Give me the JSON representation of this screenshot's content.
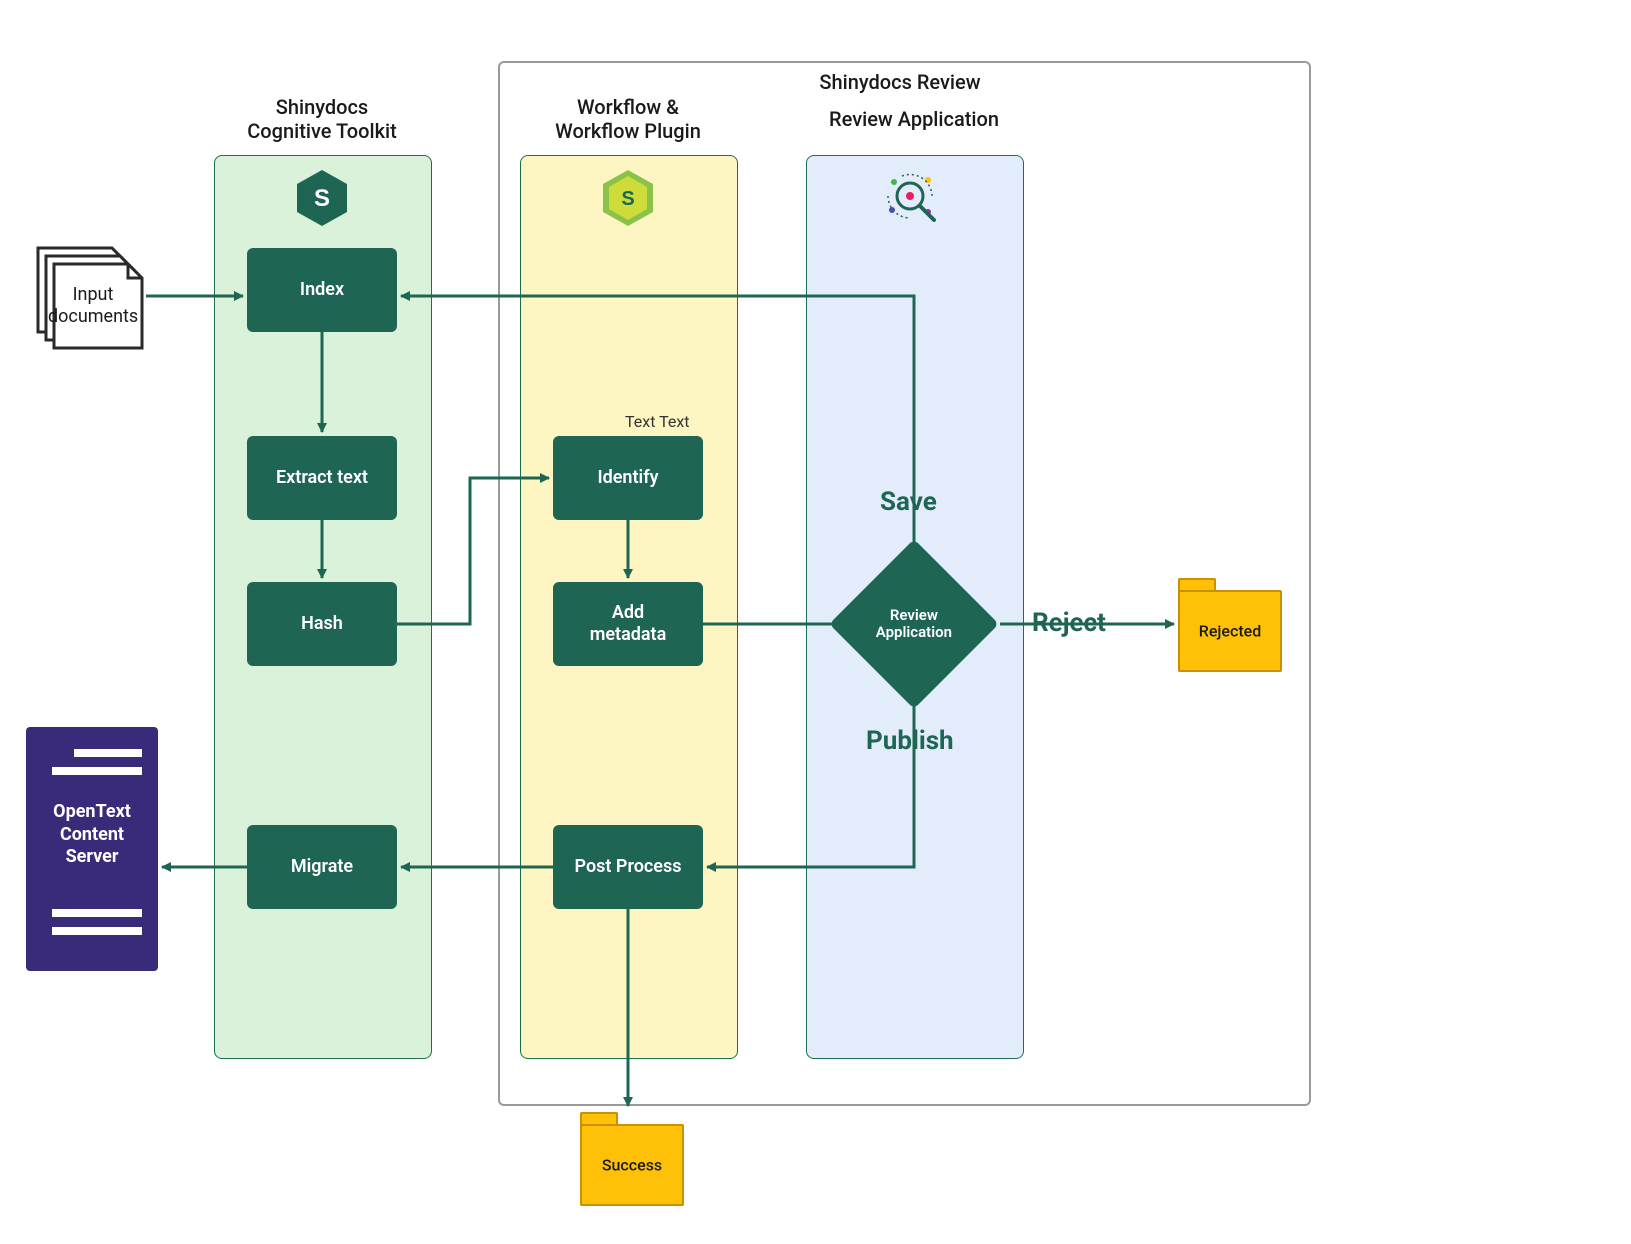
{
  "labels": {
    "cognitive_toolkit": "Shinydocs\nCognitive Toolkit",
    "workflow_plugin": "Workflow &\nWorkflow Plugin",
    "review_app": "Review Application",
    "shinydocs_review": "Shinydocs Review",
    "text_text": "Text Text"
  },
  "nodes": {
    "index": "Index",
    "extract_text": "Extract text",
    "hash": "Hash",
    "migrate": "Migrate",
    "identify": "Identify",
    "add_metadata": "Add\nmetadata",
    "post_process": "Post Process",
    "review_application": "Review\nApplication"
  },
  "actions": {
    "save": "Save",
    "publish": "Publish",
    "reject": "Reject"
  },
  "external": {
    "opentext": "OpenText\nContent\nServer",
    "input_docs": "Input\ndocuments",
    "rejected_folder": "Rejected",
    "success_folder": "Success"
  },
  "colors": {
    "node": "#1e6653",
    "server": "#3a2a7a",
    "folder": "#ffc107",
    "lane_green": "#d9f2d9",
    "lane_yellow": "#fdf6c2",
    "lane_blue": "#e3ecfb"
  }
}
